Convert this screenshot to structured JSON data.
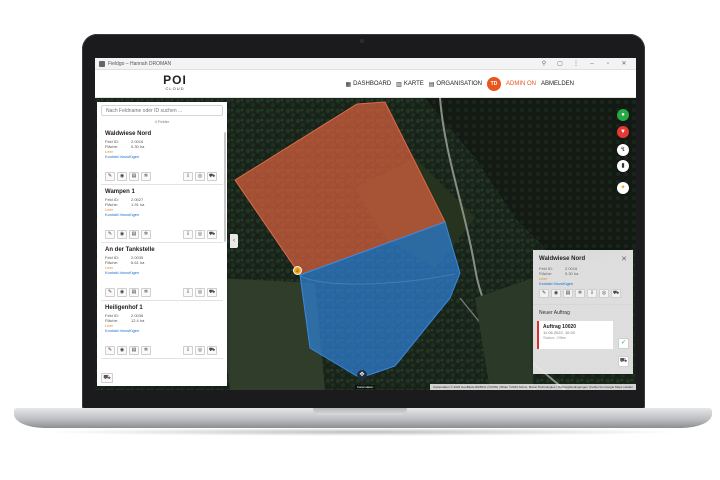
{
  "window": {
    "title": "Fieldgo – Hannah DROMAN",
    "buttons": [
      "⚲",
      "▢",
      "⋮",
      "–",
      "▫",
      "✕"
    ]
  },
  "brand": {
    "logo_main": "POI",
    "logo_sub": "CLOUD"
  },
  "nav": {
    "dashboard": "DASHBOARD",
    "karte": "KARTE",
    "organisation": "ORGANISATION",
    "avatar_initials": "TD",
    "admin_on": "ADMIN ON",
    "logout": "ABMELDEN"
  },
  "panel": {
    "search_placeholder": "Nach Feldname oder ID suchen ...",
    "filter_label": "4 Felder",
    "cards": [
      {
        "title": "Waldwiese Nord",
        "id_label": "Feld ID:",
        "id": "2.0016",
        "area_label": "Fläche:",
        "area": "5.30 ha",
        "status": "Leer",
        "contact": "Kontakt hinzufügen"
      },
      {
        "title": "Wampen 1",
        "id_label": "Feld ID:",
        "id": "2.0027",
        "area_label": "Fläche:",
        "area": "1.91 ha",
        "status": "Leer",
        "contact": "Kontakt hinzufügen"
      },
      {
        "title": "An der Tankstelle",
        "id_label": "Feld ID:",
        "id": "2.0035",
        "area_label": "Fläche:",
        "area": "6.61 ha",
        "status": "Leer",
        "contact": "Kontakt hinzufügen"
      },
      {
        "title": "Heiligenhof 1",
        "id_label": "Feld ID:",
        "id": "2.0036",
        "area_label": "Fläche:",
        "area": "12.4 ha",
        "status": "Leer",
        "contact": "Kontakt hinzufügen"
      }
    ]
  },
  "detail": {
    "title": "Waldwiese Nord",
    "id_label": "Feld ID:",
    "id": "2.0016",
    "area_label": "Fläche:",
    "area": "5.30 ha",
    "status": "Leer",
    "contact": "Kontakt hinzufügen",
    "new_order": "Neuer Auftrag",
    "order": {
      "title": "Auftrag 10020",
      "date": "11.06.2022, 10:20",
      "state": "Status: Offen"
    }
  },
  "map": {
    "attribution": "Kartendaten © 2023 GeoBasis-DE/BKG (©2009) | Bilder ©2023 Airbus, Maxar Technologies | Nutzungsbedingungen | Fehler bei Google Maps melden",
    "logo_text": "Kartendaten",
    "marker_label": "2"
  },
  "colors": {
    "accent": "#e8551d",
    "field_red": "#d9603f",
    "field_blue": "#2f7fd6",
    "status_orange": "#e08a1e",
    "link_blue": "#1b6fd1",
    "order_red": "#d6312f",
    "ctrl_green": "#27a844",
    "ctrl_red": "#e53935",
    "ctrl_orange": "#f39c12"
  }
}
